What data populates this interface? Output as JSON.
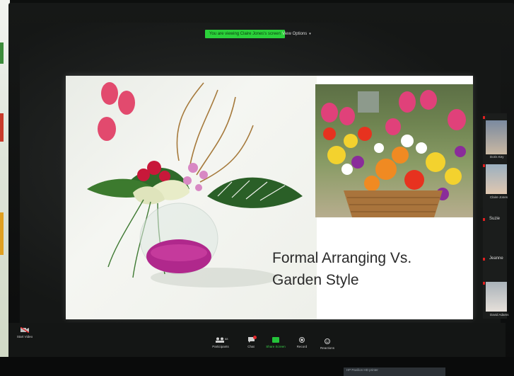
{
  "meeting": {
    "share_banner": "You are viewing Claire Jones's screen",
    "view_options": "View Options"
  },
  "slide": {
    "title_line1": "Formal Arranging Vs.",
    "title_line2": "Garden Style"
  },
  "gallery": {
    "participant1": "Doris Key",
    "participant2": "Claire Jones",
    "participant3": "Suzie",
    "participant4": "Jeanne",
    "participant5": "David Adams"
  },
  "toolbar": {
    "start_video": "Start Video",
    "participants": "Participants",
    "participants_count": "68",
    "chat": "Chat",
    "share_screen": "Share Screen",
    "record": "Record",
    "reactions": "Reactions"
  },
  "sticker": {
    "text": "HP Pavilion HD printer"
  },
  "colors": {
    "share_green": "#2bd13a",
    "slide_bg": "#ffffff",
    "badge_red": "#e0262a"
  }
}
